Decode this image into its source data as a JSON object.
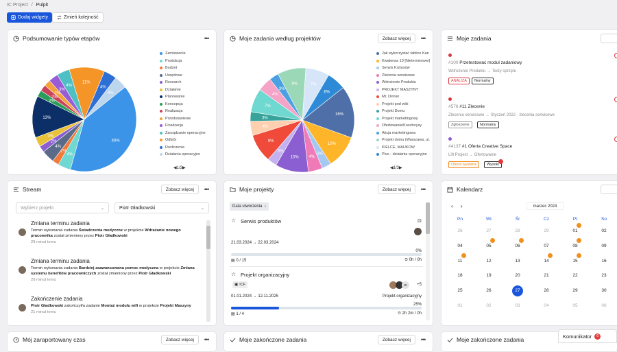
{
  "breadcrumb": {
    "project": "IC Project",
    "sep": "/",
    "current": "Pulpit"
  },
  "toolbar": {
    "add_widgets": "Dodaj widgety",
    "change_order": "Zmień kolejność"
  },
  "common": {
    "see_more": "Zobacz więcej",
    "dots": "•••"
  },
  "widget_stages": {
    "title": "Podsumowanie typów etapów",
    "pager": "1/3"
  },
  "widget_tasks_projects": {
    "title": "Moje zadania według projektów",
    "pager": "1/3"
  },
  "widget_my_tasks": {
    "title": "Moje zadania",
    "tasks": [
      {
        "num": "#100",
        "title": "Przetestować moduł zadaniowy",
        "path": "Wdrożenie Produktu → Testy sprzętu",
        "tags": [
          "ANALIZA",
          "Normalny"
        ]
      },
      {
        "num": "#576",
        "id": "#11",
        "title": "Zlecenie",
        "path": "Zlecenia serwisowe → Styczeń 2022 - zlecenia serwisowe",
        "tags": [
          "Zgłoszenie",
          "Normalny"
        ]
      },
      {
        "num": "#4137",
        "id": "#1",
        "title": "Oferta Creative Space",
        "path": "Lift Project → Ofertowanie",
        "tags": [
          "Oferta wysłana",
          "Wysoki"
        ]
      }
    ]
  },
  "widget_stream": {
    "title": "Stream",
    "filter_project": "Wybierz projekt",
    "filter_user": "Piotr Gładkowski",
    "events": [
      {
        "title": "Zmiana terminu zadania",
        "pre": "Termin wykonania zadania ",
        "task": "Świadczenia medyczne",
        "mid": " w projekcie ",
        "project": "Wdrażanie nowego pracownika",
        "post": " został zmieniony przez ",
        "user": "Piotr Gładkowski",
        "ago": "29 minut temu"
      },
      {
        "title": "Zmiana terminu zadania",
        "pre": "Termin wykonania zadania ",
        "task": "Bardziej zaawansowana pomoc medyczna",
        "mid": " w projekcie ",
        "project": "Zmiana systemu benefitów pracowniczych",
        "post": " został zmieniony przez ",
        "user": "Piotr Gładkowski",
        "ago": "29 minut temu"
      },
      {
        "title": "Zakończenie zadania",
        "pre": "",
        "user_first": "Piotr Gładkowski",
        "mid2": " zakończył/a zadanie ",
        "task": "Montaż modułu wifi",
        "mid": " w projekcie ",
        "project": "Projekt Maszyny",
        "ago": "21 minut temu"
      }
    ]
  },
  "widget_projects": {
    "title": "Moje projekty",
    "sort": "Data utworzenia",
    "projects": [
      {
        "name": "Serwis produktów",
        "dates": "21.03.2024 → 22.03.2024",
        "percent": "0%",
        "progress": 0,
        "tasks": "0 / 15",
        "time": "0h / 0h"
      },
      {
        "name": "Projekt organizacyjny",
        "tag": "ICF",
        "members_extra": "+5",
        "initials": "JK",
        "dates": "01.01.2024 → 12.11.2025",
        "type": "Projekt organizacyjny",
        "percent": "25%",
        "progress": 25,
        "tasks": "1 / 4",
        "time": "2h 2m / 0h"
      }
    ]
  },
  "widget_calendar": {
    "title": "Kalendarz",
    "month": "marzec 2024",
    "weekdays": [
      "Pn",
      "Wt",
      "Śr",
      "Cz",
      "Pt",
      "So"
    ],
    "rows": [
      [
        "26",
        "27",
        "28",
        "29",
        "01",
        "02"
      ],
      [
        "04",
        "05",
        "06",
        "07",
        "08",
        "09"
      ],
      [
        "11",
        "12",
        "13",
        "14",
        "15",
        "16"
      ],
      [
        "18",
        "19",
        "20",
        "21",
        "22",
        "23"
      ],
      [
        "25",
        "26",
        "27",
        "28",
        "29",
        "30"
      ],
      [
        "01",
        "02",
        "03",
        "04",
        "05",
        "06"
      ]
    ],
    "today": "27"
  },
  "widget_time": {
    "title": "Mój zaraportowany czas"
  },
  "widget_done1": {
    "title": "Moje zakończone zadania"
  },
  "widget_done2": {
    "title": "Moje zakończone zadania"
  },
  "chat": {
    "label": "Komunikator",
    "count": "6"
  },
  "chart_data": [
    {
      "type": "pie",
      "title": "Podsumowanie typów etapów",
      "categories": [
        "Zamówienie",
        "Produkcja",
        "Budżet",
        "Urzędowe",
        "Research",
        "Działanie",
        "Planowanie",
        "Koncepcja",
        "Realizacja",
        "Przedstawienie",
        "Finalizacja",
        "Zarządzanie operacyjne",
        "Odbiór",
        "Rozliczenie",
        "Działania operacyjne"
      ],
      "values": [
        40,
        4,
        2,
        4,
        2,
        3,
        13,
        2,
        2,
        2,
        3,
        4,
        11,
        4,
        4
      ],
      "colors": [
        "#3b94e8",
        "#6fd8d0",
        "#f07a3a",
        "#5a6b8a",
        "#8b5fd1",
        "#e9c23a",
        "#0b2f66",
        "#2a9d5a",
        "#c9435a",
        "#f4a23a",
        "#9a5bd6",
        "#4ec0c4",
        "#f59528",
        "#2e6fd6",
        "#bcd6ee"
      ]
    },
    {
      "type": "pie",
      "title": "Moje zadania według projektów",
      "categories": [
        "Jak wykorzystać tablice Kan",
        "Kwaterwa 10 [Nieterminowe]",
        "Serwis Krztusów",
        "Zlecenia serwisowe",
        "Wdrożenie Produktu",
        "PROJEKT MASZYNY",
        "Mr. Dinner",
        "Projekt pod wiki",
        "Projekt Domu",
        "Projekt marketingowy",
        "Ofertowanie/Kosztorysy",
        "Akcja marketingowa",
        "Projekt domu (Warszawa, ul.",
        "KIELCE, MAUKOW",
        "Pivo - działania operacyjne"
      ],
      "values": [
        11,
        7,
        2,
        3,
        7,
        2,
        6,
        3,
        2,
        5,
        3,
        2,
        6,
        5,
        4
      ],
      "colors": [
        "#4f6fa8",
        "#ffb52a",
        "#a4c8f0",
        "#f07ab8",
        "#8b5fd1",
        "#c4b2f0",
        "#ef4a3a",
        "#ffd0b0",
        "#38a39b",
        "#6fd8d0",
        "#f5a3c6",
        "#4aa0e0",
        "#9ad8b8",
        "#d6e6f8",
        "#2e8ad6"
      ]
    }
  ]
}
